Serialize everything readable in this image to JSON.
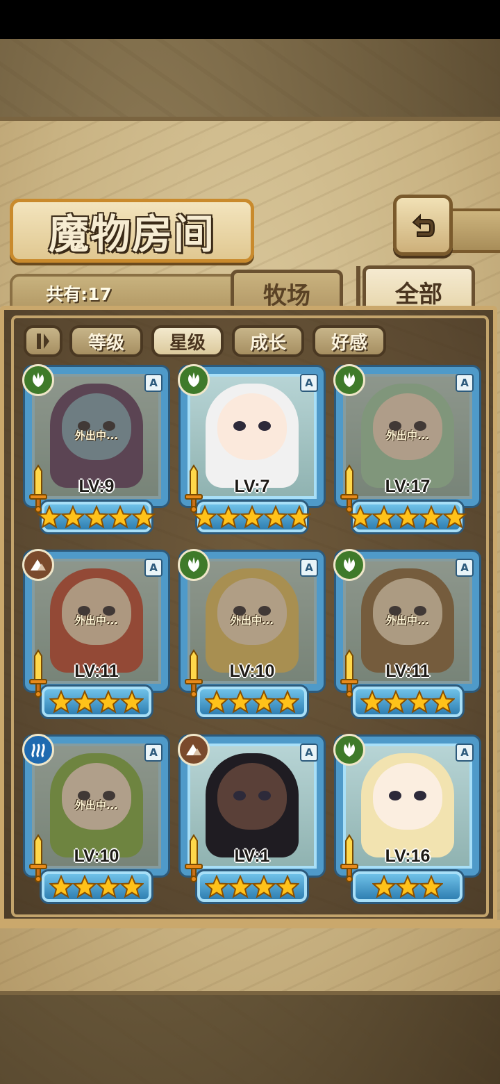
{
  "title": "魔物房间",
  "count_label": "共有:17",
  "tabs": {
    "pasture": "牧场",
    "all": "全部"
  },
  "filters": [
    "等级",
    "星级",
    "成长",
    "好感"
  ],
  "active_filter": "星级",
  "away_text": "外出中...",
  "rank_letter": "A",
  "colors": {
    "nature_badge": "#3f7a2a",
    "earth_badge": "#7a4a2c",
    "water_badge": "#1f6ab0",
    "frame_blue": "#4f9ac9",
    "star_gold": "#ffc21a"
  },
  "monsters": [
    {
      "level": "LV:9",
      "stars": 5,
      "element": "nature-icon",
      "away": true,
      "hair": "#5b3f6e",
      "skin": "#7fa6c3"
    },
    {
      "level": "LV:7",
      "stars": 5,
      "element": "nature-icon",
      "away": false,
      "hair": "#f1f1f1",
      "skin": "#fbe9dc"
    },
    {
      "level": "LV:17",
      "stars": 5,
      "element": "nature-icon",
      "away": true,
      "hair": "#9fd3b6",
      "skin": "#f4e1cf"
    },
    {
      "level": "LV:11",
      "stars": 4,
      "element": "earth-icon",
      "away": true,
      "hair": "#c2483a",
      "skin": "#f0d7c0"
    },
    {
      "level": "LV:10",
      "stars": 4,
      "element": "nature-icon",
      "away": true,
      "hair": "#e8c66a",
      "skin": "#f6e2c8"
    },
    {
      "level": "LV:11",
      "stars": 4,
      "element": "nature-icon",
      "away": true,
      "hair": "#8a6a45",
      "skin": "#efdcc3"
    },
    {
      "level": "LV:10",
      "stars": 4,
      "element": "water-icon",
      "away": true,
      "hair": "#7fb24c",
      "skin": "#f6e3d2"
    },
    {
      "level": "LV:1",
      "stars": 4,
      "element": "earth-icon",
      "away": false,
      "hair": "#1f1c22",
      "skin": "#5a4038"
    },
    {
      "level": "LV:16",
      "stars": 3,
      "element": "nature-icon",
      "away": false,
      "hair": "#f2e3b0",
      "skin": "#fbeee0"
    }
  ]
}
